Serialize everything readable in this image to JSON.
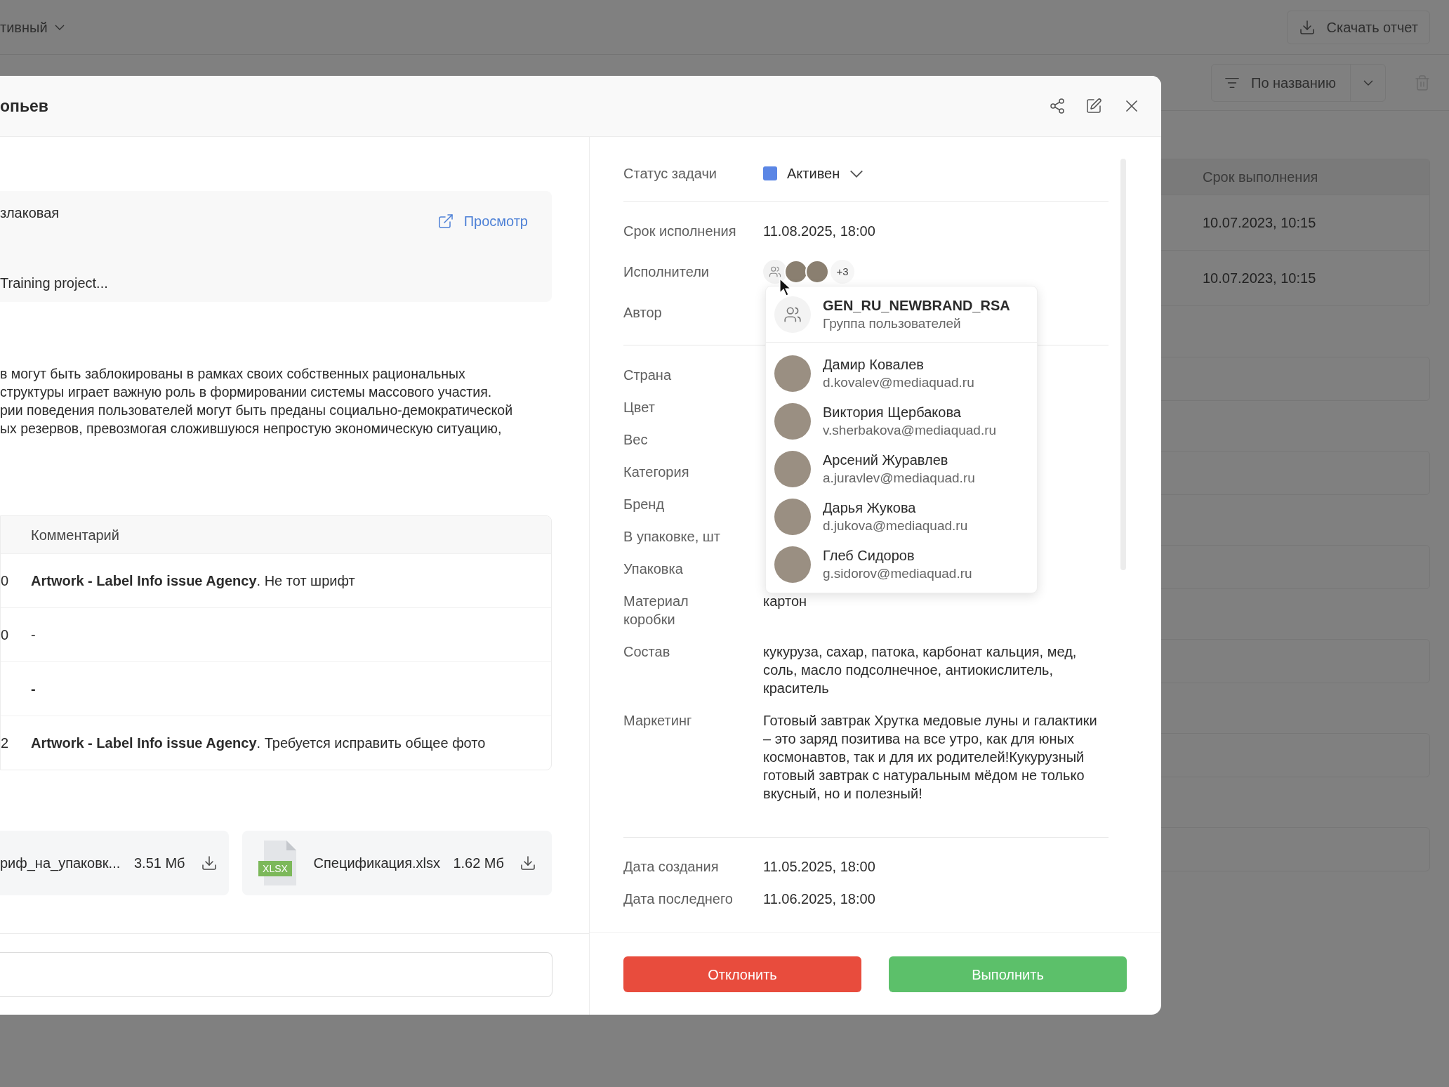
{
  "background": {
    "filter_value": "тивный",
    "download_button": "Скачать отчет",
    "sort_label": "По названию",
    "table": {
      "columns": [
        "Срок выполнения"
      ],
      "rows": [
        "10.07.2023, 10:15",
        "10.07.2023, 10:15"
      ]
    }
  },
  "modal": {
    "title": "опьев",
    "preview": {
      "line_1": "злаковая",
      "line_2": "Training project...",
      "link": "Просмотр"
    },
    "description_lines": [
      "в могут быть заблокированы в рамках своих собственных рациональных",
      "структуры играет важную роль в формировании системы массового участия.",
      "рии поведения пользователей могут быть преданы социально-демократической",
      "ых резервов, превозмогая сложившуюся непростую экономическую ситуацию,"
    ],
    "comments": {
      "columns": [
        "Комментарий"
      ],
      "rows": [
        {
          "column_1": "0",
          "comment": "**Artwork - Label Info issue Agency**. Не тот шрифт"
        },
        {
          "column_1": "0",
          "comment": "-"
        },
        {
          "comment": "**-**"
        },
        {
          "column_1": "2",
          "comment": "**Artwork - Label Info issue Agency**. Требуется исправить общее фото"
        }
      ]
    },
    "attachments": [
      {
        "kind": "file",
        "name": "риф_на_упаковк...",
        "size": "3.51 Мб"
      },
      {
        "kind": "xlsx",
        "badge": "XLSX",
        "name": "Спецификация.xlsx",
        "size": "1.62 Мб"
      }
    ],
    "details": [
      [
        {
          "kind": "status",
          "label": "Статус задачи",
          "value": "Активен",
          "color": "#5b86e5"
        }
      ],
      [
        {
          "kind": "text",
          "label": "Срок исполнения",
          "value": "11.08.2025, 18:00"
        },
        {
          "kind": "assignees",
          "label": "Исполнители",
          "avatars": [
            {
              "kind": "group"
            },
            {
              "kind": "photo"
            },
            {
              "kind": "photo"
            }
          ],
          "extra": "+3"
        },
        {
          "kind": "text",
          "label": "Автор"
        }
      ],
      [
        {
          "kind": "text",
          "label": "Страна"
        },
        {
          "kind": "text",
          "label": "Цвет"
        },
        {
          "kind": "text",
          "label": "Вес"
        },
        {
          "kind": "text",
          "label": "Категория"
        },
        {
          "kind": "text",
          "label": "Бренд"
        },
        {
          "kind": "text",
          "label": "В упаковке, шт"
        },
        {
          "kind": "text",
          "label": "Упаковка"
        },
        {
          "kind": "text",
          "label": "Материал\nкоробки",
          "value": "картон"
        },
        {
          "kind": "text",
          "label": "Состав",
          "value": "кукуруза, сахар, патока, карбонат кальция, мед, соль, масло подсолнечное, антиокислитель, краситель"
        },
        {
          "kind": "text",
          "label": "Маркетинг",
          "value": "Готовый завтрак Хрутка медовые луны и галактики – это заряд позитива на все утро, как для юных космонавтов, так и для их родителей!Кукурузный готовый завтрак с натуральным мёдом не только вкусный, но и полезный!"
        }
      ],
      [
        {
          "kind": "text",
          "label": "Дата создания",
          "value": "11.05.2025, 18:00"
        },
        {
          "kind": "text",
          "label": "Дата последнего",
          "value": "11.06.2025, 18:00"
        }
      ]
    ],
    "assignee_popup": {
      "group": {
        "name": "GEN_RU_NEWBRAND_RSA",
        "subtitle": "Группа пользователей"
      },
      "people": [
        {
          "name": "Дамир Ковалев",
          "email": "d.kovalev@mediaquad.ru"
        },
        {
          "name": "Виктория Щербакова",
          "email": "v.sherbakova@mediaquad.ru"
        },
        {
          "name": "Арсений Журавлев",
          "email": "a.juravlev@mediaquad.ru"
        },
        {
          "name": "Дарья Жукова",
          "email": "d.jukova@mediaquad.ru"
        },
        {
          "name": "Глеб Сидоров",
          "email": "g.sidorov@mediaquad.ru"
        }
      ]
    },
    "actions": [
      {
        "kind": "reject",
        "label": "Отклонить"
      },
      {
        "kind": "confirm",
        "label": "Выполнить"
      }
    ]
  }
}
